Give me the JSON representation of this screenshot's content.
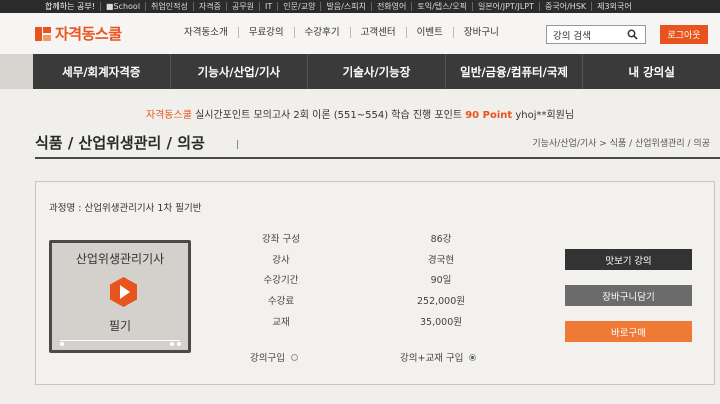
{
  "topbar": {
    "items": [
      "합께하는 공부!",
      "■School",
      "취업인적성",
      "자격증",
      "공무원",
      "IT",
      "인문/교양",
      "발음/스피치",
      "전화영어",
      "토익/텝스/오픽",
      "일본어/JPT/JLPT",
      "중국어/HSK",
      "제3외국어"
    ]
  },
  "header": {
    "logo_text": "자격동스쿨",
    "nav": [
      "자격동소개",
      "무료강의",
      "수강후기",
      "고객센터",
      "이벤트",
      "장바구니"
    ],
    "search_placeholder": "강의 검색",
    "login_label": "로그아웃"
  },
  "categories": [
    "세무/회계자격증",
    "기능사/산업/기사",
    "기술사/기능장",
    "일반/금융/컴퓨터/국제",
    "내 강의실"
  ],
  "notice": {
    "brand": "자격동스쿨",
    "text": " 실시간포인트 모의고사 2회 이론 (551~554) 학습 진행 포인트 ",
    "point": "90 Point",
    "user": " yhoj**회원님"
  },
  "page": {
    "title": "식품 / 산업위생관리 / 의공",
    "breadcrumb": "기능사/산업/기사 > 식품 / 산업위생관리 / 의공"
  },
  "course": {
    "name_label": "과정명 :",
    "name": "산업위생관리기사 1차 필기반",
    "thumb_title": "산업위생관리기사",
    "thumb_sub": "필기",
    "info": [
      {
        "label": "강좌 구성",
        "value": "86강"
      },
      {
        "label": "강사",
        "value": "경국현"
      },
      {
        "label": "수강기간",
        "value": "90일"
      },
      {
        "label": "수강료",
        "value": "252,000원"
      },
      {
        "label": "교재",
        "value": "35,000원"
      }
    ],
    "option_lecture": "강의구입",
    "option_lecture_book": "강의+교재 구입",
    "selected_option": "강의+교재 구입",
    "btn_preview": "맛보기 강의",
    "btn_cart": "장바구니담기",
    "btn_buy": "바로구매"
  },
  "colors": {
    "accent": "#e8541d",
    "dark": "#333333"
  }
}
